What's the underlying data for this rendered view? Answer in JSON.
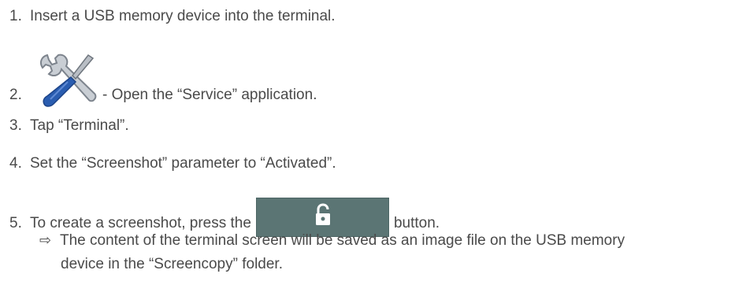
{
  "steps": [
    {
      "num": "1.",
      "text": "Insert a USB memory device into the terminal."
    },
    {
      "num": "2.",
      "text": "- Open the “Service” application.",
      "icon": "wrench-screwdriver-icon"
    },
    {
      "num": "3.",
      "text": "Tap “Terminal”."
    },
    {
      "num": "4.",
      "text": "Set the “Screenshot” parameter to “Activated”."
    },
    {
      "num": "5.",
      "text_before": "To create a screenshot, press the",
      "text_after": "button.",
      "button_icon": "unlock-icon"
    }
  ],
  "result": {
    "arrow": "⇨",
    "line1": "The content of the terminal screen will be saved as an image file on the USB memory",
    "line2": "device in the “Screencopy” folder."
  },
  "colors": {
    "text": "#4a4a4a",
    "button_bg": "#5b7574",
    "icon_blue": "#2a5db0",
    "icon_gray": "#8a9099"
  }
}
